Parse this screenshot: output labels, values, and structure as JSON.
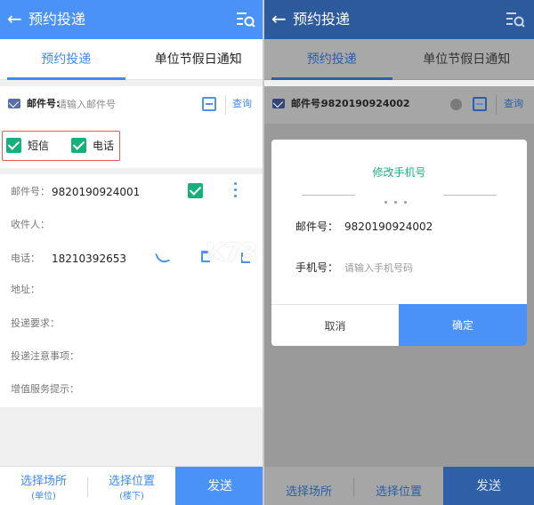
{
  "colors": {
    "primary": "#4a92f7",
    "checked": "#16b07a",
    "highlight_border": "#e25b55",
    "overlay": "#9a9a9a"
  },
  "left_screen": {
    "header": {
      "back_icon": "arrow-left-icon",
      "title": "预约投递",
      "action_icon": "list-search-icon"
    },
    "tabs": [
      {
        "label": "预约投递",
        "active": true
      },
      {
        "label": "单位节假日通知",
        "active": false
      }
    ],
    "search": {
      "icon": "mail-icon",
      "label": "邮件号:",
      "placeholder": "请输入邮件号",
      "scan_icon": "scan-icon",
      "query_label": "查询"
    },
    "notify_options": [
      {
        "label": "短信",
        "checked": true
      },
      {
        "label": "电话",
        "checked": true
      }
    ],
    "card": {
      "mail_label": "邮件号：",
      "mail_value": "9820190924001",
      "recipient_label": "收件人：",
      "phone_label": "电话：",
      "phone_value": "18210392653",
      "address_label": "地址：",
      "delivery_req_label": "投递要求：",
      "delivery_notes_label": "投递注意事项：",
      "value_added_label": "增值服务提示："
    },
    "bottom": {
      "place_label": "选择场所",
      "place_value": "(单位)",
      "position_label": "选择位置",
      "position_value": "(楼下)",
      "send_label": "发送"
    }
  },
  "right_screen": {
    "header": {
      "back_icon": "arrow-left-icon",
      "title": "预约投递",
      "action_icon": "list-search-icon"
    },
    "tabs": [
      {
        "label": "预约投递",
        "active": true
      },
      {
        "label": "单位节假日通知",
        "active": false
      }
    ],
    "search": {
      "label": "邮件号:",
      "value": "9820190924002",
      "query_label": "查询"
    },
    "modal": {
      "title": "修改手机号",
      "mail_label": "邮件号：",
      "mail_value": "9820190924002",
      "phone_label": "手机号：",
      "phone_placeholder": "请输入手机号码",
      "cancel_label": "取消",
      "confirm_label": "确定"
    },
    "bottom": {
      "place_label": "选择场所",
      "position_label": "选择位置",
      "send_label": "发送"
    }
  },
  "watermark": {
    "logo": "K73",
    "text": "游戏之家",
    "url": ".com"
  }
}
